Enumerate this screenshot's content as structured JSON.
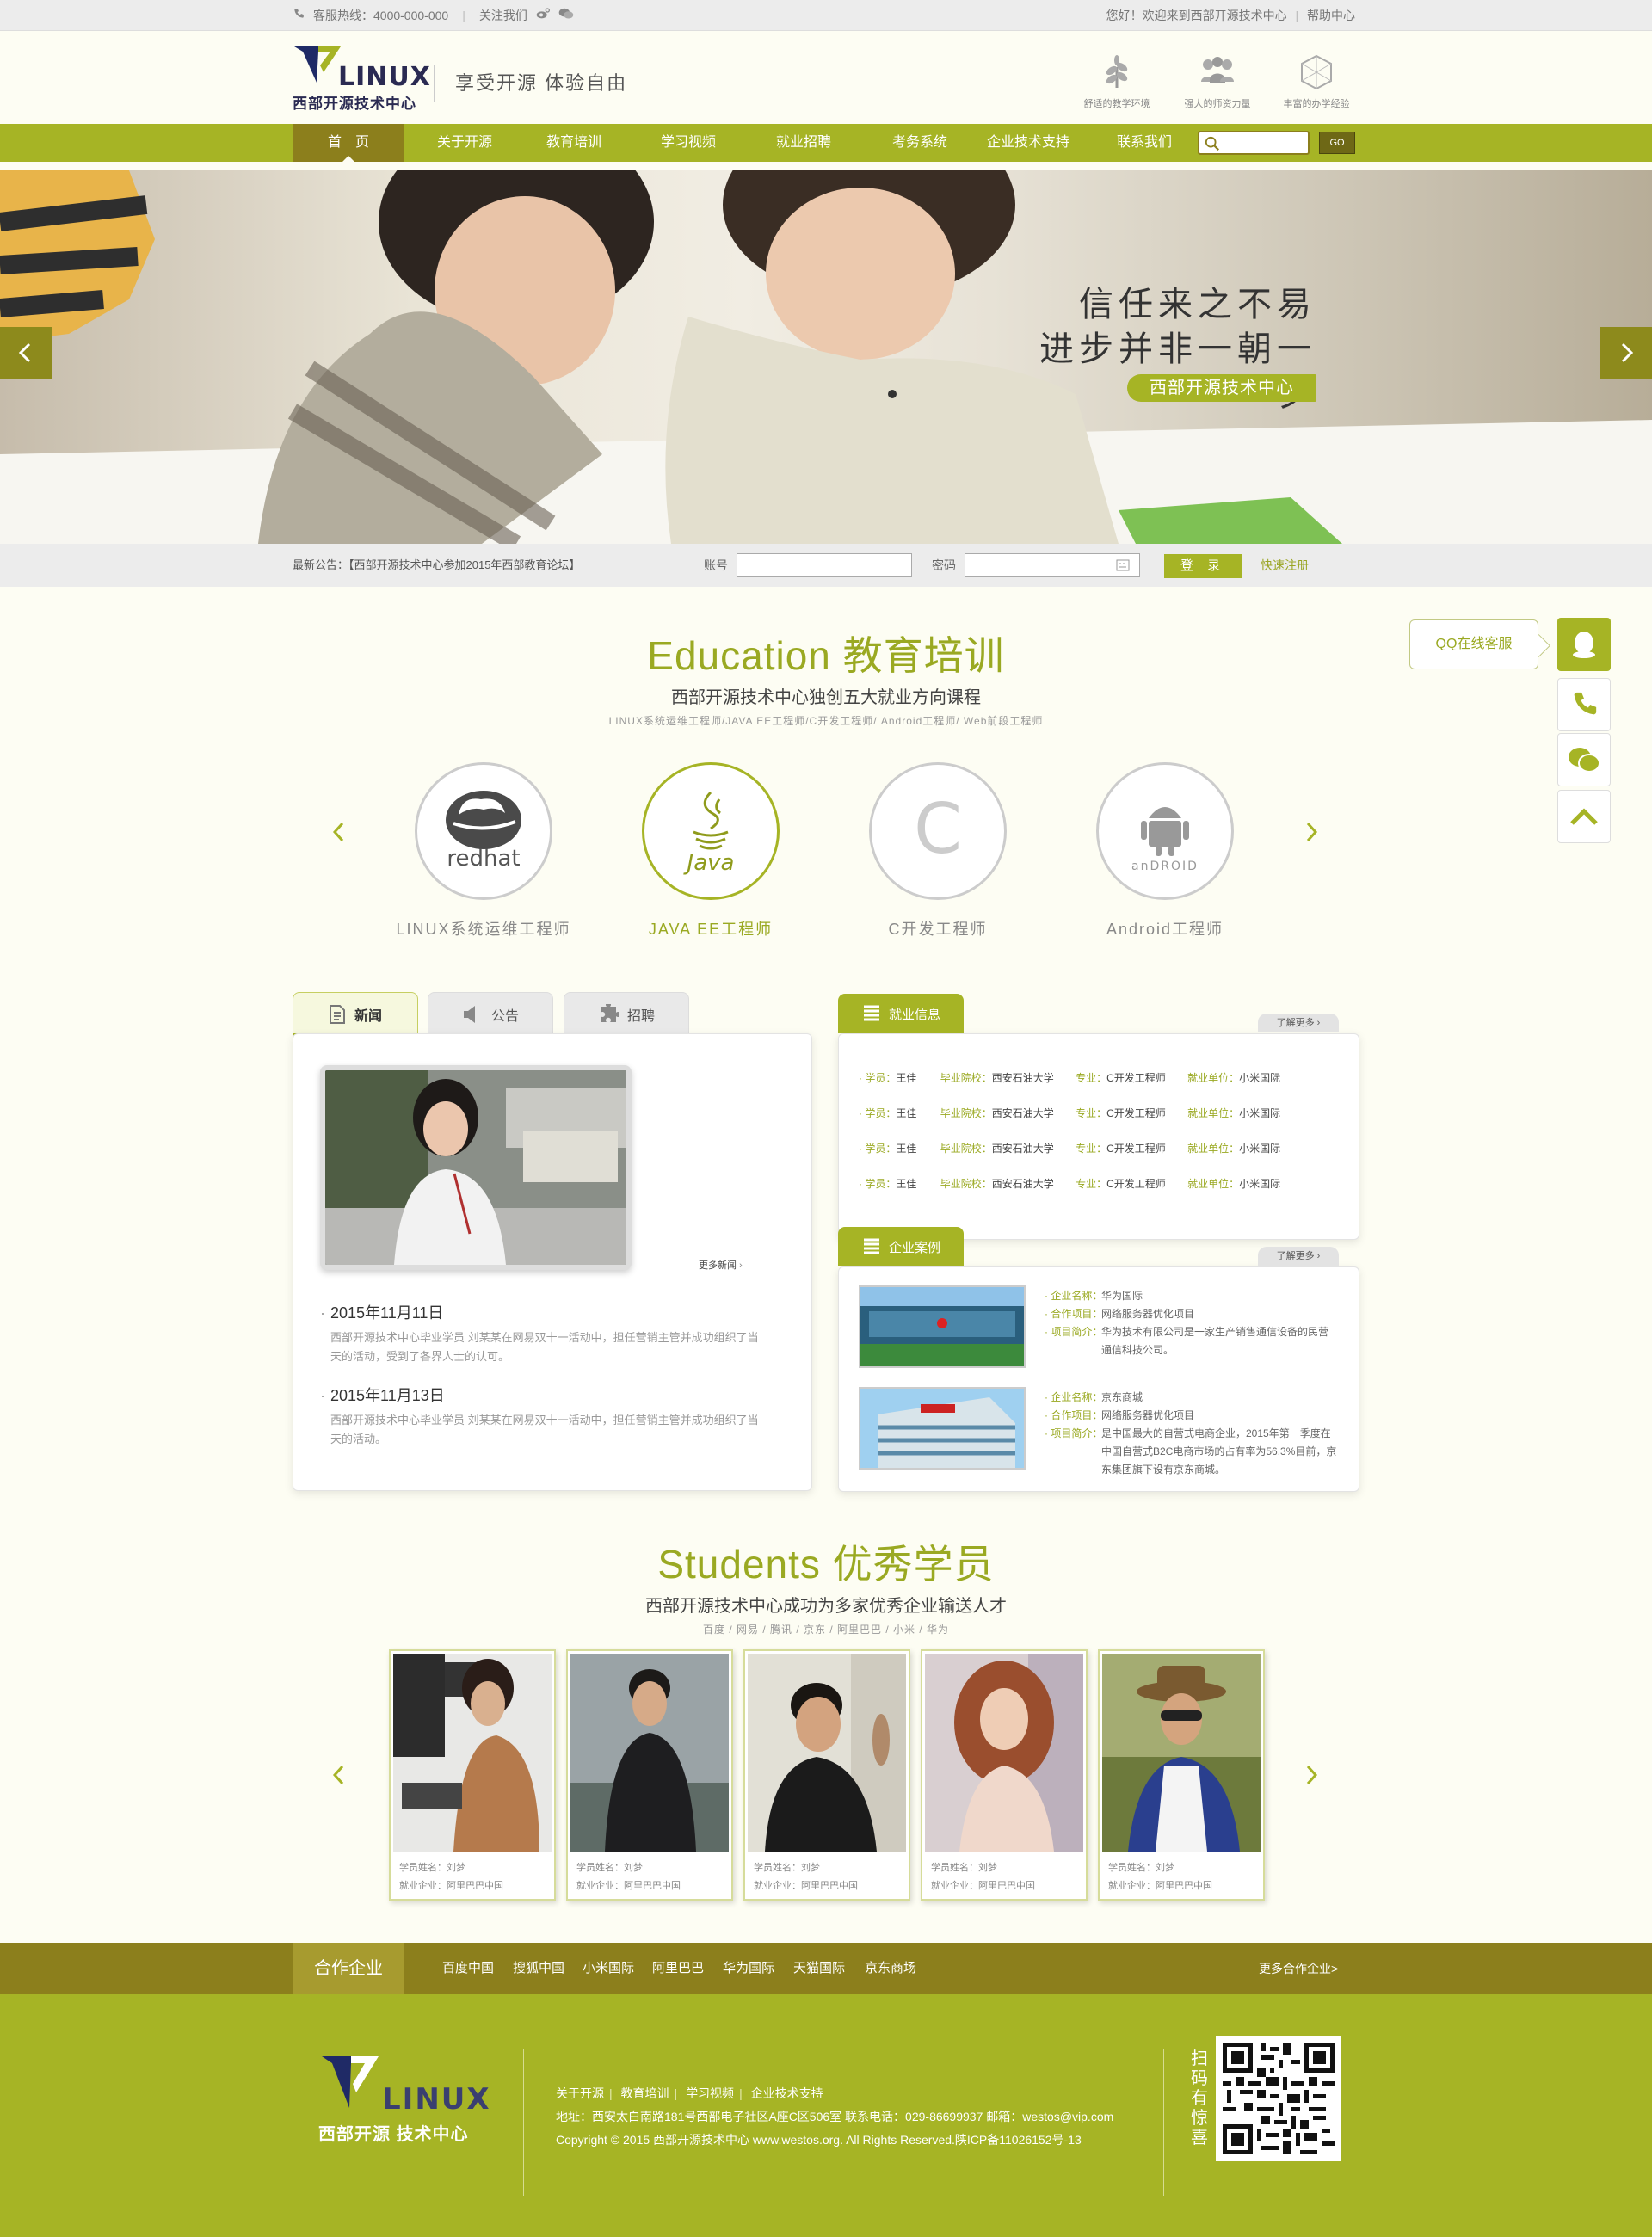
{
  "topbar": {
    "hotline": "客服热线：4000-000-000",
    "follow": "关注我们",
    "welcome": "您好！欢迎来到西部开源技术中心",
    "help": "帮助中心"
  },
  "header": {
    "logo_en": "LINUX",
    "logo_cn": "西部开源技术中心",
    "slogan": "享受开源  体验自由",
    "features": [
      {
        "icon": "leaf-icon",
        "label": "舒适的教学环境"
      },
      {
        "icon": "people-icon",
        "label": "强大的师资力量"
      },
      {
        "icon": "hexagon-icon",
        "label": "丰富的办学经验"
      }
    ]
  },
  "nav": {
    "items": [
      "首　页",
      "关于开源",
      "教育培训",
      "学习视频",
      "就业招聘",
      "考务系统",
      "企业技术支持",
      "联系我们"
    ],
    "active_index": 0,
    "search_go": "GO"
  },
  "banner": {
    "line1": "信任来之不易",
    "line2": "进步并非一朝一夕",
    "tag": "西部开源技术中心"
  },
  "loginbar": {
    "notice": "最新公告：【西部开源技术中心参加2015年西部教育论坛】",
    "account_label": "账号",
    "password_label": "密码",
    "login_button": "登 录",
    "register_link": "快速注册"
  },
  "education": {
    "title": "Education 教育培训",
    "subtitle": "西部开源技术中心独创五大就业方向课程",
    "tags": "LINUX系统运维工程师/JAVA EE工程师/C开发工程师/ Android工程师/ Web前段工程师",
    "courses": [
      {
        "label": "LINUX系统运维工程师",
        "logo": "redhat"
      },
      {
        "label": "JAVA EE工程师",
        "logo": "Java"
      },
      {
        "label": "C开发工程师",
        "logo": "C"
      },
      {
        "label": "Android工程师",
        "logo": "anDROID"
      }
    ],
    "active_index": 1
  },
  "floating": {
    "qq_label": "QQ在线客服"
  },
  "news": {
    "tabs": [
      "新闻",
      "公告",
      "招聘"
    ],
    "more": "更多新闻",
    "items": [
      {
        "date": "2015年11月11日",
        "text": "西部开源技术中心毕业学员 刘某某在网易双十一活动中，担任营销主管并成功组织了当天的活动，受到了各界人士的认可。"
      },
      {
        "date": "2015年11月13日",
        "text": "西部开源技术中心毕业学员 刘某某在网易双十一活动中，担任营销主管并成功组织了当天的活动。"
      }
    ]
  },
  "jobs": {
    "title": "就业信息",
    "more": "了解更多",
    "labels": {
      "student": "学员：",
      "school": "毕业院校：",
      "major": "专业：",
      "company": "就业单位："
    },
    "rows": [
      {
        "student": "王佳",
        "school": "西安石油大学",
        "major": "C开发工程师",
        "company": "小米国际"
      },
      {
        "student": "王佳",
        "school": "西安石油大学",
        "major": "C开发工程师",
        "company": "小米国际"
      },
      {
        "student": "王佳",
        "school": "西安石油大学",
        "major": "C开发工程师",
        "company": "小米国际"
      },
      {
        "student": "王佳",
        "school": "西安石油大学",
        "major": "C开发工程师",
        "company": "小米国际"
      }
    ]
  },
  "cases": {
    "title": "企业案例",
    "more": "了解更多",
    "labels": {
      "name": "企业名称：",
      "project": "合作项目：",
      "intro": "项目简介："
    },
    "items": [
      {
        "name": "华为国际",
        "project": "网络服务器优化项目",
        "intro": "华为技术有限公司是一家生产销售通信设备的民营通信科技公司。"
      },
      {
        "name": "京东商城",
        "project": "网络服务器优化项目",
        "intro": "是中国最大的自营式电商企业，2015年第一季度在中国自营式B2C电商市场的占有率为56.3%目前，京东集团旗下设有京东商城。"
      }
    ]
  },
  "students": {
    "title": "Students  优秀学员",
    "subtitle": "西部开源技术中心成功为多家优秀企业输送人才",
    "companies": "百度 / 网易 / 腾讯 / 京东 / 阿里巴巴 / 小米 / 华为",
    "name_label": "学员姓名：",
    "company_label": "就业企业：",
    "items": [
      {
        "name": "刘梦",
        "company": "阿里巴巴中国"
      },
      {
        "name": "刘梦",
        "company": "阿里巴巴中国"
      },
      {
        "name": "刘梦",
        "company": "阿里巴巴中国"
      },
      {
        "name": "刘梦",
        "company": "阿里巴巴中国"
      },
      {
        "name": "刘梦",
        "company": "阿里巴巴中国"
      }
    ]
  },
  "partners": {
    "title": "合作企业",
    "items": [
      "百度中国",
      "搜狐中国",
      "小米国际",
      "阿里巴巴",
      "华为国际",
      "天猫国际",
      "京东商场"
    ],
    "more": "更多合作企业>"
  },
  "footer": {
    "links": [
      "关于开源",
      "教育培训",
      "学习视频",
      "企业技术支持"
    ],
    "address": "地址：西安太白南路181号西部电子社区A座C区506室   联系电话：029-86699937   邮箱：westos@vip.com",
    "copyright": "Copyright © 2015 西部开源技术中心 www.westos.org. All Rights Reserved.陕ICP备11026152号-13",
    "scan": "扫码有惊喜",
    "logo_en": "LINUX",
    "logo_cn": "西部开源 技术中心"
  },
  "colors": {
    "accent": "#a6b425",
    "dark_accent": "#8c7f1c",
    "title_green": "#9aa922"
  }
}
